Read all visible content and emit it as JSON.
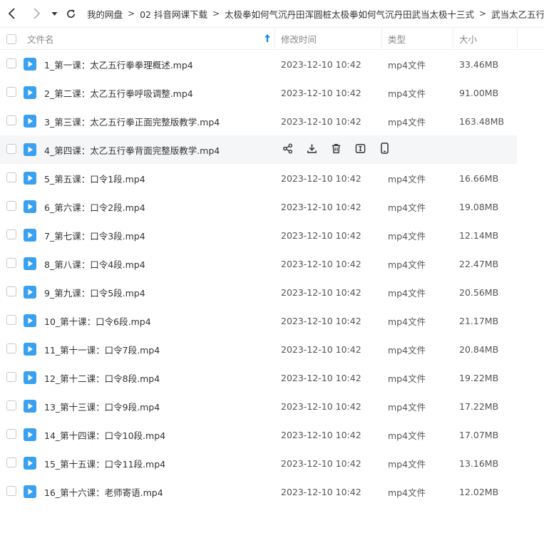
{
  "nav": {
    "back_icon": "chevron-left-icon",
    "forward_icon": "chevron-right-icon",
    "history_icon": "caret-down-icon",
    "refresh_icon": "refresh-icon"
  },
  "breadcrumb": [
    "我的网盘",
    "02 抖音网课下载",
    "太极拳如何气沉丹田浑圆桩太极拳如何气沉丹田武当太极十三式",
    "武当太乙五行拳详"
  ],
  "columns": {
    "name": "文件名",
    "modified": "修改时间",
    "type": "类型",
    "size": "大小"
  },
  "colors": {
    "file_icon": "#3aa0f0",
    "hover_row": "#f5f6f8",
    "sort_arrow": "#1e88e5"
  },
  "hover_actions": [
    "share-icon",
    "download-icon",
    "delete-icon",
    "rename-icon",
    "phone-icon"
  ],
  "files": [
    {
      "name": "1_第一课：太乙五行拳拳理概述.mp4",
      "modified": "2023-12-10 10:42",
      "type": "mp4文件",
      "size": "33.46MB"
    },
    {
      "name": "2_第二课：太乙五行拳呼吸调整.mp4",
      "modified": "2023-12-10 10:42",
      "type": "mp4文件",
      "size": "91.00MB"
    },
    {
      "name": "3_第三课：太乙五行拳正面完整版教学.mp4",
      "modified": "2023-12-10 10:42",
      "type": "mp4文件",
      "size": "163.48MB"
    },
    {
      "name": "4_第四课：太乙五行拳背面完整版教学.mp4",
      "modified": "",
      "type": "",
      "size": "",
      "hover": true
    },
    {
      "name": "5_第五课：口令1段.mp4",
      "modified": "2023-12-10 10:42",
      "type": "mp4文件",
      "size": "16.66MB"
    },
    {
      "name": "6_第六课：口令2段.mp4",
      "modified": "2023-12-10 10:42",
      "type": "mp4文件",
      "size": "19.08MB"
    },
    {
      "name": "7_第七课：口令3段.mp4",
      "modified": "2023-12-10 10:42",
      "type": "mp4文件",
      "size": "12.14MB"
    },
    {
      "name": "8_第八课：口令4段.mp4",
      "modified": "2023-12-10 10:42",
      "type": "mp4文件",
      "size": "22.47MB"
    },
    {
      "name": "9_第九课：口令5段.mp4",
      "modified": "2023-12-10 10:42",
      "type": "mp4文件",
      "size": "20.56MB"
    },
    {
      "name": "10_第十课：口令6段.mp4",
      "modified": "2023-12-10 10:42",
      "type": "mp4文件",
      "size": "21.17MB"
    },
    {
      "name": "11_第十一课：口令7段.mp4",
      "modified": "2023-12-10 10:42",
      "type": "mp4文件",
      "size": "20.84MB"
    },
    {
      "name": "12_第十二课：口令8段.mp4",
      "modified": "2023-12-10 10:42",
      "type": "mp4文件",
      "size": "19.22MB"
    },
    {
      "name": "13_第十三课：口令9段.mp4",
      "modified": "2023-12-10 10:42",
      "type": "mp4文件",
      "size": "17.22MB"
    },
    {
      "name": "14_第十四课：口令10段.mp4",
      "modified": "2023-12-10 10:42",
      "type": "mp4文件",
      "size": "17.07MB"
    },
    {
      "name": "15_第十五课：口令11段.mp4",
      "modified": "2023-12-10 10:42",
      "type": "mp4文件",
      "size": "13.16MB"
    },
    {
      "name": "16_第十六课：老师寄语.mp4",
      "modified": "2023-12-10 10:42",
      "type": "mp4文件",
      "size": "12.02MB"
    }
  ]
}
